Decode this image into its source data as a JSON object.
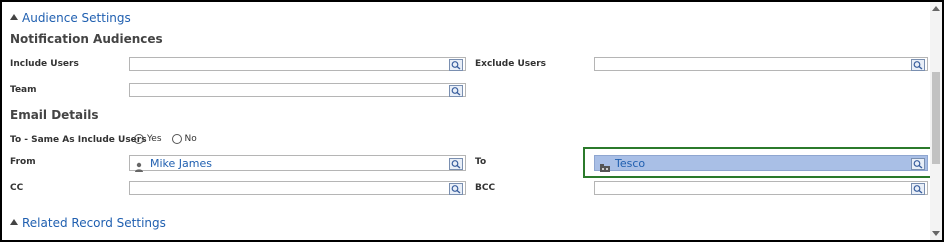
{
  "sections": {
    "audience_settings": "Audience Settings",
    "related_record_settings": "Related Record Settings"
  },
  "notification_audiences": {
    "title": "Notification Audiences",
    "include_users_label": "Include Users",
    "include_users_value": "",
    "exclude_users_label": "Exclude Users",
    "exclude_users_value": "",
    "team_label": "Team",
    "team_value": ""
  },
  "email_details": {
    "title": "Email Details",
    "to_same_label": "To - Same As Include Users",
    "yes_label": "Yes",
    "no_label": "No",
    "from_label": "From",
    "from_value": "Mike James",
    "to_label": "To",
    "to_value": "Tesco",
    "cc_label": "CC",
    "cc_value": "",
    "bcc_label": "BCC",
    "bcc_value": ""
  },
  "colors": {
    "link": "#1f5fb0",
    "selected_field": "#a9bfe6",
    "highlight": "#2b7a2b"
  },
  "icons": {
    "lookup": "magnifier-lookup-icon",
    "user": "person-icon",
    "account": "building-icon"
  }
}
